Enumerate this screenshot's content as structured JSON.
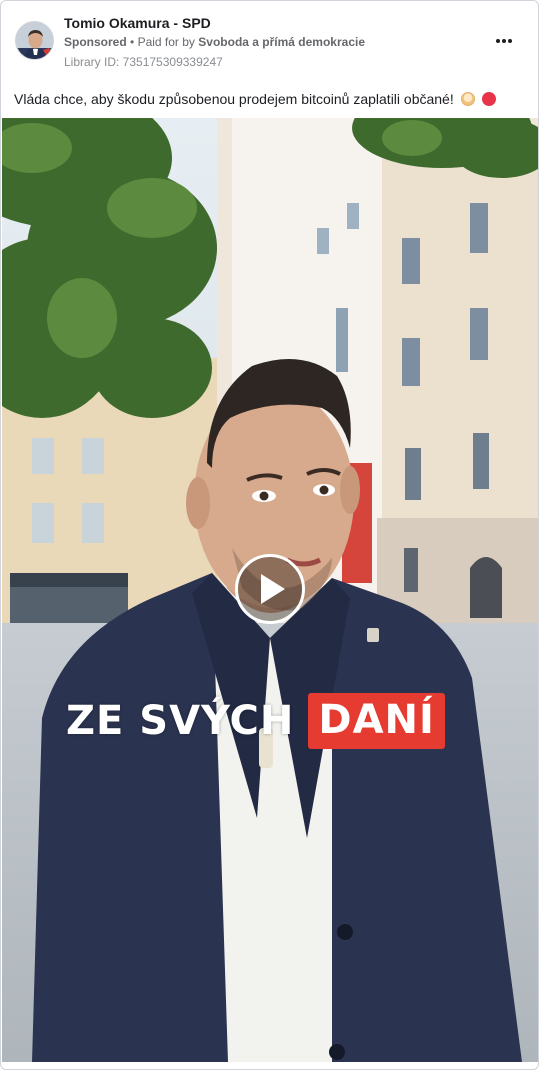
{
  "post": {
    "page_name": "Tomio Okamura - SPD",
    "sponsored_label": "Sponsored",
    "separator": "•",
    "paid_for_prefix": "Paid for by",
    "funder": "Svoboda a přímá demokracie",
    "library_id": "Library ID: 735175309339247",
    "caption": "Vláda chce, aby škodu způsobenou prodejem bitcoinů zaplatili občané!",
    "caption_emojis": [
      "older-person-emoji",
      "angry-face-emoji"
    ]
  },
  "video": {
    "overlay_text": "ZE SVÝCH",
    "overlay_highlight": "DANÍ",
    "highlight_color": "#e63b30"
  },
  "icons": {
    "more": "more-options-icon",
    "play": "play-icon"
  }
}
